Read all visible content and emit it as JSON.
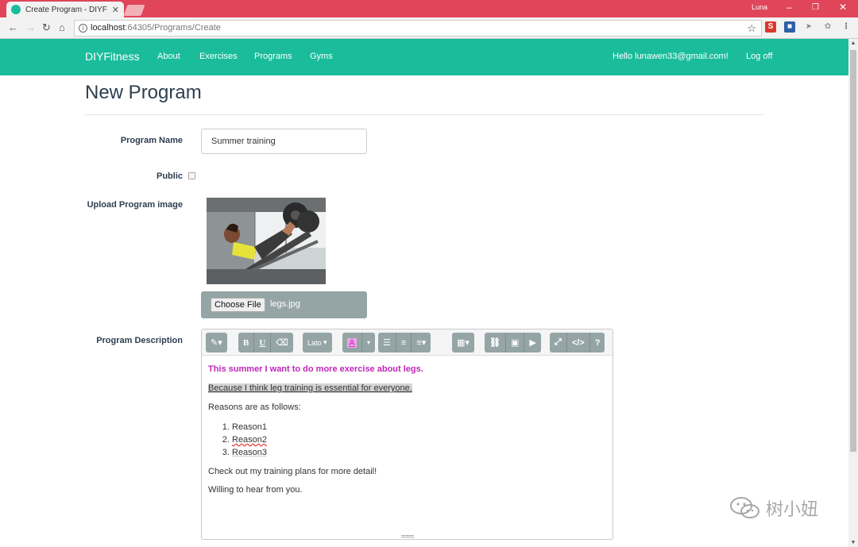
{
  "browser": {
    "tab_title": "Create Program - DIYFitn",
    "profile_name": "Luna",
    "url_host": "localhost",
    "url_path": ":64305/Programs/Create"
  },
  "navbar": {
    "brand": "DIYFitness",
    "links": [
      "About",
      "Exercises",
      "Programs",
      "Gyms"
    ],
    "greeting": "Hello lunawen33@gmail.com!",
    "logoff": "Log off"
  },
  "page": {
    "title": "New Program"
  },
  "form": {
    "program_name_label": "Program Name",
    "program_name_value": "Summer training",
    "public_label": "Public",
    "public_checked": false,
    "upload_label": "Upload Program image",
    "choose_file_label": "Choose File",
    "file_name": "legs.jpg",
    "description_label": "Program Description"
  },
  "editor": {
    "toolbar": {
      "font_name": "Lato"
    },
    "content": {
      "line1": "This summer I want to do more exercise about legs.",
      "line2": "Because I think leg training is essential for everyone.",
      "line3": "Reasons are as follows:",
      "reasons": [
        "Reason1",
        "Reason2",
        "Reason3"
      ],
      "line4": "Check out my training plans for more detail!",
      "line5": "Willing to hear from you."
    }
  },
  "watermark": {
    "text": "树小妞"
  },
  "colors": {
    "navbar": "#1abc9c",
    "titlebar": "#e0455a",
    "toolbar_group": "#95a5a6",
    "highlight_text": "#c026b8"
  }
}
